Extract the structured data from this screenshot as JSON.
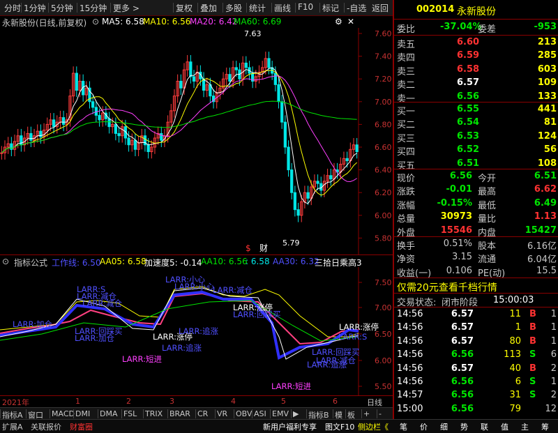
{
  "toolbar": {
    "items": [
      "分时",
      "1分钟",
      "5分钟",
      "15分钟",
      "更多 >",
      "复权",
      "叠加",
      "多股",
      "统计",
      "画线",
      "F10",
      "标记",
      "-自选",
      "返回"
    ]
  },
  "chart_header": {
    "name": "永新股份(日线,前复权)",
    "ma5": "MA5: 6.58",
    "ma10": "MA10: 6.56",
    "ma20": "MA20: 6.42",
    "ma60": "MA60: 6.69"
  },
  "main_chart": {
    "y_ticks": [
      "7.60",
      "7.40",
      "7.20",
      "7.00",
      "6.80",
      "6.60",
      "6.40",
      "6.20",
      "6.00",
      "5.80"
    ],
    "high_label": "7.63",
    "low_label": "5.79",
    "markers": [
      "$",
      "财"
    ]
  },
  "indicator_header": {
    "name": "指标公式",
    "gzx": "工作线: 6.50",
    "aa05": "AA05: 6.58",
    "jsd": "加速度5: -0.14",
    "aa10": "AA10: 6.56",
    "v1": ": 6.58",
    "aa30": "AA30: 6.32",
    "tail": "三拾日乘高3"
  },
  "indicator_chart": {
    "y_ticks": [
      "7.50",
      "7.00",
      "6.50",
      "6.00",
      "5.50"
    ],
    "annotations": [
      {
        "text": "LARR:小心",
        "color": "#5050ff"
      },
      {
        "text": "LARR:S",
        "color": "#5050ff"
      },
      {
        "text": "LARR:减仓",
        "color": "#5050ff"
      },
      {
        "text": "LARR:减仓",
        "color": "#5050ff"
      },
      {
        "text": "LARR:加仓",
        "color": "#5050ff"
      },
      {
        "text": "LARR:加仓",
        "color": "#5050ff"
      },
      {
        "text": "LARR:回踩买",
        "color": "#5050ff"
      },
      {
        "text": "LARR:涨停",
        "color": "#ffffff"
      },
      {
        "text": "LARR:追涨",
        "color": "#5050ff"
      },
      {
        "text": "LARR:短进",
        "color": "#ff40ff"
      },
      {
        "text": "LARR:小心",
        "color": "#5050ff"
      },
      {
        "text": "LARR:减仓",
        "color": "#5050ff"
      },
      {
        "text": "LARR:涨停",
        "color": "#ffffff"
      },
      {
        "text": "LARR:回踩买",
        "color": "#5050ff"
      },
      {
        "text": "LARR:追涨",
        "color": "#5050ff"
      },
      {
        "text": "LARR:短进",
        "color": "#ff40ff"
      },
      {
        "text": "LARR:回踩买",
        "color": "#5050ff"
      },
      {
        "text": "LARR:追涨",
        "color": "#5050ff"
      },
      {
        "text": "LARR:减仓",
        "color": "#5050ff"
      },
      {
        "text": "LARR:涨停",
        "color": "#ffffff"
      },
      {
        "text": "LARR:S",
        "color": "#5050ff"
      }
    ]
  },
  "date_axis": {
    "year": "2021年",
    "months": [
      "1",
      "2",
      "3",
      "4",
      "5",
      "6"
    ],
    "period": "日线"
  },
  "indicator_tabs": [
    "指标A",
    "窗口",
    "MACD",
    "DMI",
    "DMA",
    "FSL",
    "TRIX",
    "BRAR",
    "CR",
    "VR",
    "OBV",
    "ASI",
    "EMV",
    "▶",
    "指标B",
    "模",
    "板",
    "+",
    "-"
  ],
  "bottom_bar": {
    "left": [
      "扩展A",
      "关联报价",
      "财富圈"
    ],
    "promo": "新用户福利专享",
    "f10": "图文F10",
    "sidebar": "侧边栏《",
    "right": [
      "笔",
      "价",
      "细",
      "势",
      "联",
      "值",
      "主",
      "筹"
    ]
  },
  "quote": {
    "code": "002014",
    "name": "永新股份",
    "weibi_label": "委比",
    "weibi": "-37.04%",
    "weicha_label": "委差",
    "weicha": "-953",
    "asks": [
      {
        "label": "卖五",
        "price": "6.60",
        "vol": "213",
        "color": "#ff3232"
      },
      {
        "label": "卖四",
        "price": "6.59",
        "vol": "285",
        "color": "#ff3232"
      },
      {
        "label": "卖三",
        "price": "6.58",
        "vol": "603",
        "color": "#ff3232"
      },
      {
        "label": "卖二",
        "price": "6.57",
        "vol": "109",
        "color": "#ffffff"
      },
      {
        "label": "卖一",
        "price": "6.56",
        "vol": "133",
        "color": "#00e600"
      }
    ],
    "bids": [
      {
        "label": "买一",
        "price": "6.55",
        "vol": "441",
        "color": "#00e600"
      },
      {
        "label": "买二",
        "price": "6.54",
        "vol": "81",
        "color": "#00e600"
      },
      {
        "label": "买三",
        "price": "6.53",
        "vol": "124",
        "color": "#00e600"
      },
      {
        "label": "买四",
        "price": "6.52",
        "vol": "56",
        "color": "#00e600"
      },
      {
        "label": "买五",
        "price": "6.51",
        "vol": "108",
        "color": "#00e600"
      }
    ],
    "stats1": [
      {
        "l1": "现价",
        "v1": "6.56",
        "c1": "#00e600",
        "l2": "今开",
        "v2": "6.51",
        "c2": "#00e600"
      },
      {
        "l1": "涨跌",
        "v1": "-0.01",
        "c1": "#00e600",
        "l2": "最高",
        "v2": "6.62",
        "c2": "#ff3232"
      },
      {
        "l1": "涨幅",
        "v1": "-0.15%",
        "c1": "#00e600",
        "l2": "最低",
        "v2": "6.49",
        "c2": "#00e600"
      },
      {
        "l1": "总量",
        "v1": "30973",
        "c1": "#ffff00",
        "l2": "量比",
        "v2": "1.13",
        "c2": "#ff3232"
      },
      {
        "l1": "外盘",
        "v1": "15546",
        "c1": "#ff3232",
        "l2": "内盘",
        "v2": "15427",
        "c2": "#00e600"
      }
    ],
    "stats2": [
      {
        "l1": "换手",
        "v1": "0.51%",
        "l2": "股本",
        "v2": "6.16亿"
      },
      {
        "l1": "净资",
        "v1": "3.15",
        "l2": "流通",
        "v2": "6.04亿"
      },
      {
        "l1": "收益(一)",
        "v1": "0.106",
        "l2": "PE(动)",
        "v2": "15.5"
      }
    ],
    "ad_text": "仅需20元查看千档行情",
    "status_label": "交易状态:",
    "status_value": "闭市阶段",
    "status_time": "15:00:03",
    "ticks": [
      {
        "time": "14:56",
        "price": "6.57",
        "vol": "11",
        "bs": "B",
        "n": "1",
        "pc": "#ffffff",
        "bc": "#ff3232"
      },
      {
        "time": "14:56",
        "price": "6.57",
        "vol": "1",
        "bs": "B",
        "n": "1",
        "pc": "#ffffff",
        "bc": "#ff3232"
      },
      {
        "time": "14:56",
        "price": "6.57",
        "vol": "80",
        "bs": "B",
        "n": "1",
        "pc": "#ffffff",
        "bc": "#ff3232"
      },
      {
        "time": "14:56",
        "price": "6.56",
        "vol": "113",
        "bs": "S",
        "n": "6",
        "pc": "#00e600",
        "bc": "#00e600"
      },
      {
        "time": "14:56",
        "price": "6.57",
        "vol": "40",
        "bs": "B",
        "n": "2",
        "pc": "#ffffff",
        "bc": "#ff3232"
      },
      {
        "time": "14:56",
        "price": "6.56",
        "vol": "6",
        "bs": "S",
        "n": "1",
        "pc": "#00e600",
        "bc": "#00e600"
      },
      {
        "time": "14:57",
        "price": "6.56",
        "vol": "31",
        "bs": "S",
        "n": "2",
        "pc": "#00e600",
        "bc": "#00e600"
      },
      {
        "time": "15:00",
        "price": "6.56",
        "vol": "79",
        "bs": "",
        "n": "12",
        "pc": "#00e600",
        "bc": "#00e600"
      }
    ]
  }
}
